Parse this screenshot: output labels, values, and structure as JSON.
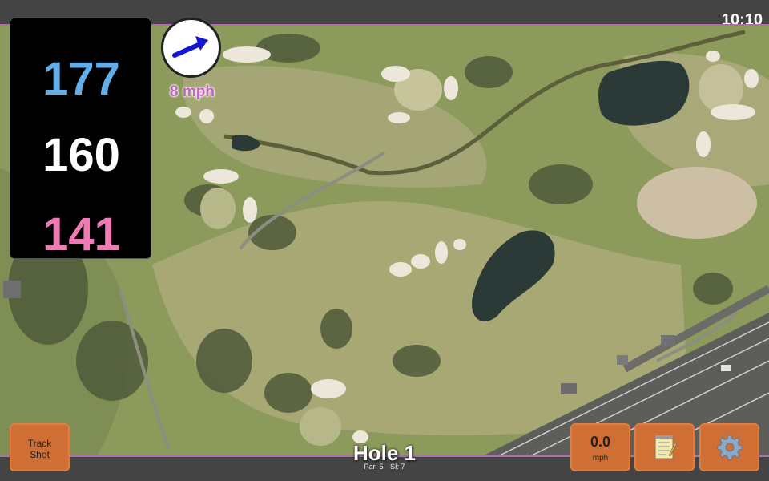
{
  "status_bar": {
    "time": "10:10"
  },
  "distances": {
    "back": "177",
    "middle": "160",
    "front": "141"
  },
  "wind": {
    "speed_label": "8 mph",
    "direction_icon": "arrow-right-icon"
  },
  "hole": {
    "title": "Hole 1",
    "par_label": "Par: 5",
    "si_label": "SI: 7"
  },
  "buttons": {
    "track_shot": {
      "label_line1": "Track",
      "label_line2": "Shot"
    },
    "speed": {
      "value": "0.0",
      "unit": "mph"
    },
    "notes": {
      "icon": "notepad-icon"
    },
    "settings": {
      "icon": "gear-icon"
    }
  },
  "colors": {
    "back_distance": "#63aee8",
    "middle_distance": "#ffffff",
    "front_distance": "#f07ab4",
    "wind_text": "#c064c0",
    "button": "#cf6f35",
    "fairway": "#a3a870",
    "rough": "#8a9a58",
    "water": "#2a3a38",
    "bunker": "#e8e2d4"
  }
}
